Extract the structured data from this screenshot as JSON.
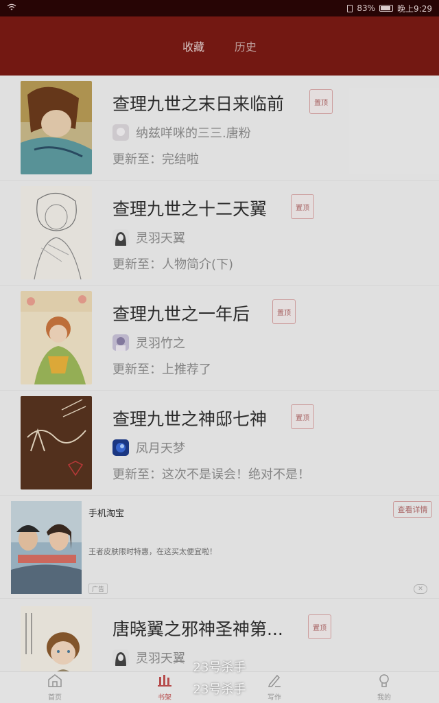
{
  "status_bar": {
    "battery": "83%",
    "time": "晚上9:29"
  },
  "header": {
    "tabs": [
      {
        "label": "收藏",
        "active": true
      },
      {
        "label": "历史",
        "active": false
      }
    ]
  },
  "pin_label": "置顶",
  "books": [
    {
      "title": "查理九世之末日来临前",
      "author": "纳兹咩咪的三三.唐粉",
      "update": "更新至：完结啦"
    },
    {
      "title": "查理九世之十二天翼",
      "author": "灵羽天翼",
      "update": "更新至：人物简介(下)"
    },
    {
      "title": "查理九世之一年后",
      "author": "灵羽竹之",
      "update": "更新至：上推荐了"
    },
    {
      "title": "查理九世之神邸七神",
      "author": "凤月天梦",
      "update": "更新至：这次不是误会！绝对不是！"
    },
    {
      "title": "唐晓翼之邪神圣神第...",
      "author": "灵羽天翼",
      "update": ""
    }
  ],
  "ad": {
    "app_name": "手机淘宝",
    "button": "查看详情",
    "description": "王者皮肤限时特惠，在这买太便宜啦！",
    "tag": "广告",
    "close": "✕"
  },
  "bottom_nav": [
    {
      "label": "首页",
      "icon": "home-icon",
      "active": false
    },
    {
      "label": "书架",
      "icon": "bookshelf-icon",
      "active": true
    },
    {
      "label": "写作",
      "icon": "pen-icon",
      "active": false
    },
    {
      "label": "我的",
      "icon": "profile-icon",
      "active": false
    }
  ],
  "toast": {
    "line1": "23号杀手",
    "line2": "23号杀手"
  },
  "colors": {
    "header": "#7a1a14",
    "accent": "#c05050"
  }
}
